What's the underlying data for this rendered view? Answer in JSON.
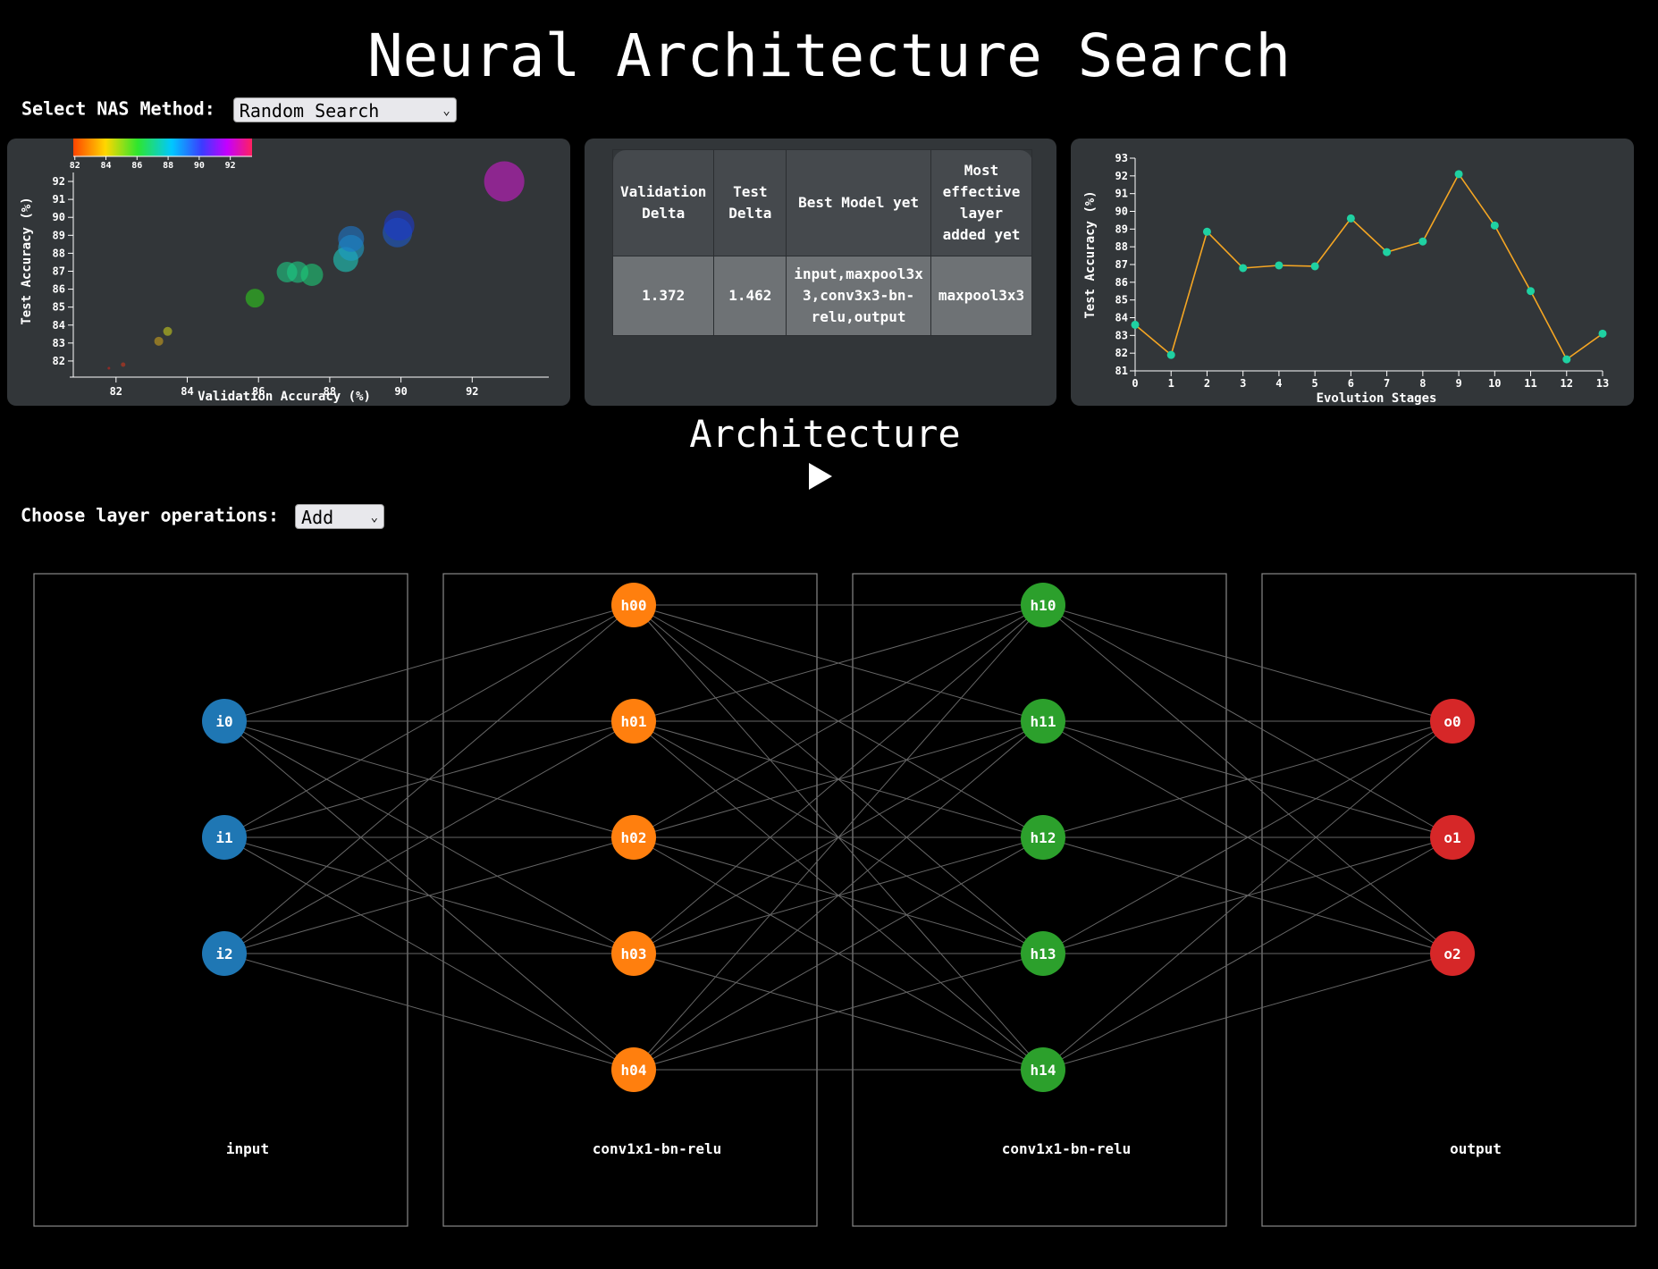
{
  "page": {
    "title": "Neural Architecture Search"
  },
  "nas_method": {
    "label": "Select NAS Method:",
    "selected": "Random Search"
  },
  "scatter": {
    "title": "",
    "xlabel": "Validation Accuracy (%)",
    "ylabel": "Test Accuracy (%)",
    "colorbar_ticks": [
      "82",
      "84",
      "86",
      "88",
      "90",
      "92"
    ]
  },
  "stats_table": {
    "headers": [
      "Validation\nDelta",
      "Test\nDelta",
      "Best Model yet",
      "Most\neffective\nlayer\nadded yet"
    ],
    "row": [
      "1.372",
      "1.462",
      "input,maxpool3x\n3,conv3x3-bn-\nrelu,output",
      "maxpool3x3"
    ]
  },
  "line": {
    "xlabel": "Evolution Stages",
    "ylabel": "Test Accuracy (%)"
  },
  "architecture": {
    "title": "Architecture",
    "play_icon": "play-icon",
    "layer_ops_label": "Choose layer operations:",
    "layer_ops_selected": "Add",
    "layers": [
      {
        "name": "input",
        "color": "#1f77b4",
        "nodes": [
          "i0",
          "i1",
          "i2"
        ]
      },
      {
        "name": "conv1x1-bn-relu",
        "color": "#ff7f0e",
        "nodes": [
          "h00",
          "h01",
          "h02",
          "h03",
          "h04"
        ]
      },
      {
        "name": "conv1x1-bn-relu",
        "color": "#2ca02c",
        "nodes": [
          "h10",
          "h11",
          "h12",
          "h13",
          "h14"
        ]
      },
      {
        "name": "output",
        "color": "#d62728",
        "nodes": [
          "o0",
          "o1",
          "o2"
        ]
      }
    ]
  },
  "chart_data": [
    {
      "type": "scatter",
      "xlabel": "Validation Accuracy (%)",
      "ylabel": "Test Accuracy (%)",
      "xlim": [
        80.8,
        93.9
      ],
      "ylim": [
        81.4,
        92.3
      ],
      "xticks": [
        82,
        84,
        86,
        88,
        90,
        92
      ],
      "yticks": [
        82,
        83,
        84,
        85,
        86,
        87,
        88,
        89,
        90,
        91,
        92
      ],
      "colorbar": {
        "range": [
          81.9,
          93.4
        ],
        "ticks": [
          82,
          84,
          86,
          88,
          90,
          92
        ],
        "scheme": "rainbow"
      },
      "points": [
        {
          "x": 81.8,
          "y": 81.6,
          "size": 0.3
        },
        {
          "x": 82.2,
          "y": 81.8,
          "size": 0.5
        },
        {
          "x": 83.2,
          "y": 83.1,
          "size": 1.0
        },
        {
          "x": 83.45,
          "y": 83.65,
          "size": 1.0
        },
        {
          "x": 85.9,
          "y": 85.5,
          "size": 2.1
        },
        {
          "x": 86.8,
          "y": 86.95,
          "size": 2.3
        },
        {
          "x": 87.1,
          "y": 86.95,
          "size": 2.4
        },
        {
          "x": 87.5,
          "y": 86.8,
          "size": 2.5
        },
        {
          "x": 88.45,
          "y": 87.65,
          "size": 2.8
        },
        {
          "x": 88.6,
          "y": 88.3,
          "size": 2.9
        },
        {
          "x": 88.6,
          "y": 88.8,
          "size": 2.9
        },
        {
          "x": 89.9,
          "y": 89.15,
          "size": 3.3
        },
        {
          "x": 89.95,
          "y": 89.55,
          "size": 3.4
        },
        {
          "x": 92.9,
          "y": 92.0,
          "size": 4.5
        }
      ]
    },
    {
      "type": "line",
      "xlabel": "Evolution Stages",
      "ylabel": "Test Accuracy (%)",
      "xlim": [
        0,
        13
      ],
      "ylim": [
        81,
        93
      ],
      "x": [
        0,
        1,
        2,
        3,
        4,
        5,
        6,
        7,
        8,
        9,
        10,
        11,
        12,
        13
      ],
      "series": [
        {
          "values": [
            83.6,
            81.9,
            88.85,
            86.8,
            86.95,
            86.9,
            89.6,
            87.7,
            88.3,
            92.1,
            89.2,
            85.5,
            81.65,
            83.1
          ]
        }
      ],
      "line_color": "#f5a623",
      "marker_color": "#1fd1a2"
    }
  ]
}
